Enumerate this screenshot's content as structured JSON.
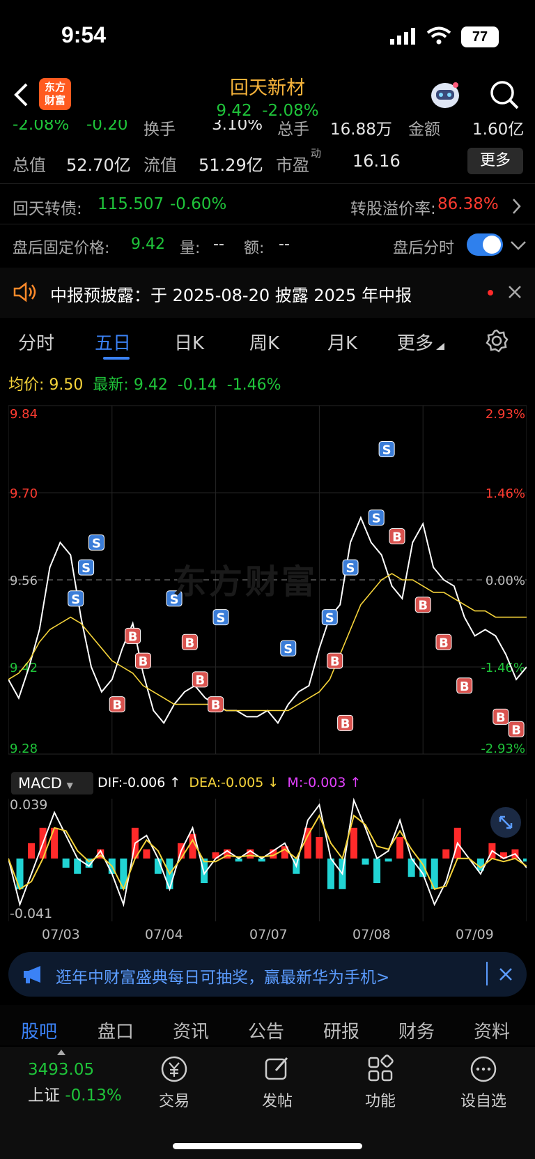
{
  "status": {
    "time": "9:54",
    "battery": "77"
  },
  "header": {
    "logo_line1": "东方",
    "logo_line2": "财富",
    "title": "回天新材",
    "price": "9.42",
    "change_pct": "-2.08%"
  },
  "quote_row1": {
    "pct": "-2.08%",
    "chg": "-0.20",
    "turnover_label": "换手",
    "turnover": "3.10%",
    "volume_label": "总手",
    "volume": "16.88万",
    "amount_label": "金额",
    "amount": "1.60亿"
  },
  "quote_row2": {
    "mktcap_label": "总值",
    "mktcap": "52.70亿",
    "float_label": "流值",
    "float": "51.29亿",
    "pe_label": "市盈",
    "pe_sup": "动",
    "pe": "16.16",
    "more": "更多"
  },
  "bond": {
    "label": "回天转债:",
    "price": "115.507",
    "pct": "-0.60%",
    "premium_label": "转股溢价率:",
    "premium": "86.38%"
  },
  "after_hours": {
    "label": "盘后固定价格:",
    "price": "9.42",
    "vol_label": "量:",
    "vol": "--",
    "amt_label": "额:",
    "amt": "--",
    "timeshare": "盘后分时"
  },
  "notice": {
    "text": "中报预披露：于 2025-08-20 披露 2025 年中报"
  },
  "chart_tabs": [
    "分时",
    "五日",
    "日K",
    "周K",
    "月K",
    "更多"
  ],
  "avg_row": {
    "avg_label": "均价:",
    "avg": "9.50",
    "latest_label": "最新:",
    "latest": "9.42",
    "chg": "-0.14",
    "pct": "-1.46%"
  },
  "watermark": "东方财富",
  "chart_data": {
    "type": "line",
    "title": "",
    "x": [
      "07/03",
      "07/04",
      "07/07",
      "07/08",
      "07/09"
    ],
    "ylim": [
      9.28,
      9.84
    ],
    "y_ticks_left": [
      "9.84",
      "9.70",
      "9.56",
      "9.42",
      "9.28"
    ],
    "y_ticks_right": [
      "2.93%",
      "1.46%",
      "0.00%",
      "-1.46%",
      "-2.93%"
    ],
    "prev_close": 9.56,
    "grid": true,
    "series": [
      {
        "values": [
          9.4,
          9.37,
          9.42,
          9.48,
          9.58,
          9.62,
          9.6,
          9.5,
          9.42,
          9.38,
          9.4,
          9.45,
          9.49,
          9.41,
          9.35,
          9.33,
          9.36,
          9.38,
          9.39,
          9.37,
          9.36,
          9.35,
          9.35,
          9.34,
          9.34,
          9.35,
          9.33,
          9.36,
          9.38,
          9.39,
          9.45,
          9.5,
          9.52,
          9.62,
          9.66,
          9.62,
          9.6,
          9.55,
          9.53,
          9.62,
          9.65,
          9.58,
          9.56,
          9.55,
          9.5,
          9.47,
          9.48,
          9.47,
          9.44,
          9.4,
          9.42
        ]
      },
      {
        "values": [
          9.4,
          9.41,
          9.43,
          9.46,
          9.48,
          9.49,
          9.5,
          9.49,
          9.47,
          9.45,
          9.43,
          9.42,
          9.41,
          9.39,
          9.38,
          9.37,
          9.36,
          9.36,
          9.36,
          9.36,
          9.36,
          9.35,
          9.35,
          9.35,
          9.35,
          9.35,
          9.35,
          9.35,
          9.36,
          9.37,
          9.38,
          9.4,
          9.44,
          9.48,
          9.52,
          9.54,
          9.56,
          9.57,
          9.56,
          9.56,
          9.55,
          9.54,
          9.54,
          9.53,
          9.52,
          9.51,
          9.51,
          9.5,
          9.5,
          9.5,
          9.5
        ]
      }
    ],
    "markers": [
      {
        "label": "S",
        "x": 0.13,
        "y": 9.53
      },
      {
        "label": "S",
        "x": 0.15,
        "y": 9.58
      },
      {
        "label": "S",
        "x": 0.17,
        "y": 9.62
      },
      {
        "label": "B",
        "x": 0.24,
        "y": 9.47
      },
      {
        "label": "B",
        "x": 0.26,
        "y": 9.43
      },
      {
        "label": "B",
        "x": 0.21,
        "y": 9.36
      },
      {
        "label": "S",
        "x": 0.32,
        "y": 9.53
      },
      {
        "label": "B",
        "x": 0.35,
        "y": 9.46
      },
      {
        "label": "B",
        "x": 0.37,
        "y": 9.4
      },
      {
        "label": "B",
        "x": 0.4,
        "y": 9.36
      },
      {
        "label": "S",
        "x": 0.41,
        "y": 9.5
      },
      {
        "label": "S",
        "x": 0.54,
        "y": 9.45
      },
      {
        "label": "S",
        "x": 0.62,
        "y": 9.5
      },
      {
        "label": "S",
        "x": 0.66,
        "y": 9.58
      },
      {
        "label": "B",
        "x": 0.63,
        "y": 9.43
      },
      {
        "label": "B",
        "x": 0.65,
        "y": 9.33
      },
      {
        "label": "S",
        "x": 0.71,
        "y": 9.66
      },
      {
        "label": "S",
        "x": 0.73,
        "y": 9.77
      },
      {
        "label": "B",
        "x": 0.75,
        "y": 9.63
      },
      {
        "label": "B",
        "x": 0.8,
        "y": 9.52
      },
      {
        "label": "B",
        "x": 0.84,
        "y": 9.46
      },
      {
        "label": "B",
        "x": 0.88,
        "y": 9.39
      },
      {
        "label": "B",
        "x": 0.95,
        "y": 9.34
      },
      {
        "label": "B",
        "x": 0.98,
        "y": 9.32
      }
    ]
  },
  "macd": {
    "label": "MACD",
    "dif": "DIF:-0.006 ↑",
    "dea": "DEA:-0.005 ↓",
    "m": "M:-0.003 ↑",
    "ylim": [
      -0.041,
      0.039
    ],
    "top_label": "0.039",
    "bottom_label": "-0.041",
    "dif_values": [
      0.0,
      -0.03,
      -0.01,
      0.01,
      0.03,
      0.015,
      0.0,
      -0.005,
      0.005,
      -0.01,
      -0.03,
      0.01,
      0.015,
      0.0,
      -0.02,
      0.005,
      0.02,
      -0.01,
      0.0,
      0.005,
      0.0,
      0.005,
      0.0,
      0.005,
      0.01,
      -0.005,
      0.025,
      0.035,
      0.0,
      -0.01,
      0.038,
      0.02,
      0.0,
      0.005,
      0.025,
      0.0,
      -0.01,
      -0.03,
      -0.015,
      0.01,
      0.0,
      -0.01,
      0.005,
      0.0,
      0.003,
      -0.006
    ],
    "dea_values": [
      0.0,
      -0.02,
      -0.015,
      0.0,
      0.02,
      0.018,
      0.005,
      -0.002,
      0.002,
      -0.005,
      -0.02,
      0.0,
      0.012,
      0.005,
      -0.01,
      0.0,
      0.012,
      -0.002,
      -0.002,
      0.002,
      0.001,
      0.002,
      0.001,
      0.002,
      0.006,
      0.0,
      0.015,
      0.028,
      0.01,
      0.0,
      0.028,
      0.022,
      0.008,
      0.006,
      0.018,
      0.006,
      -0.004,
      -0.02,
      -0.018,
      0.0,
      0.0,
      -0.006,
      0.0,
      -0.002,
      0.0,
      -0.005
    ]
  },
  "banner": {
    "text": "逛年中财富盛典每日可抽奖，赢最新华为手机>"
  },
  "bottom_tabs": [
    "股吧",
    "盘口",
    "资讯",
    "公告",
    "研报",
    "财务",
    "资料"
  ],
  "index": {
    "value": "3493.05",
    "name": "上证",
    "pct": "-0.13%"
  },
  "nav": [
    {
      "label": "交易",
      "icon": "yuan-icon"
    },
    {
      "label": "发帖",
      "icon": "edit-icon"
    },
    {
      "label": "功能",
      "icon": "grid-icon"
    },
    {
      "label": "设自选",
      "icon": "more-icon"
    }
  ]
}
